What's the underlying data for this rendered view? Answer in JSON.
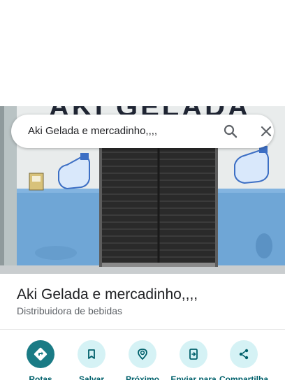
{
  "search": {
    "query": "Aki Gelada e mercadinho,,,,"
  },
  "place": {
    "name": "Aki Gelada e mercadinho,,,,",
    "category": "Distribuidora de bebidas"
  },
  "photo": {
    "sign_text": "AKI GELADA"
  },
  "actions": [
    {
      "label": "Rotas",
      "icon": "directions-icon"
    },
    {
      "label": "Salvar",
      "icon": "bookmark-icon"
    },
    {
      "label": "Próximo",
      "icon": "nearby-icon"
    },
    {
      "label": "Enviar para",
      "icon": "send-to-phone-icon"
    },
    {
      "label": "Compartilha",
      "icon": "share-icon"
    }
  ],
  "colors": {
    "accent": "#1a7b85",
    "action_bg": "#d5f2f5",
    "action_text": "#00606b",
    "wall_blue": "#6fa6d6"
  }
}
